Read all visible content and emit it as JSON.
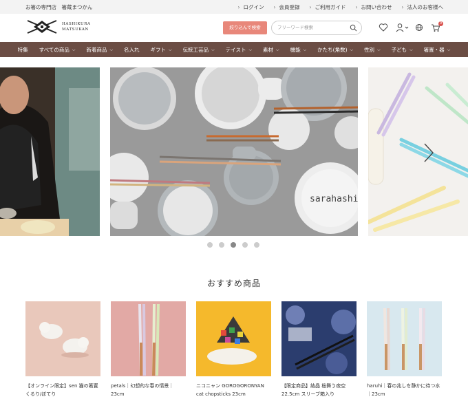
{
  "topbar": {
    "store_name": "お箸の専門店　箸蔵まつかん",
    "links": [
      "ログイン",
      "会員登録",
      "ご利用ガイド",
      "お問い合わせ",
      "法人のお客様へ"
    ]
  },
  "header": {
    "logo_line1": "HASHIKURA",
    "logo_line2": "MATSUKAN",
    "filter_button": "絞り込んで検索",
    "search_placeholder": "フリーワード検索",
    "cart_count": "0"
  },
  "nav": {
    "items": [
      "特集",
      "すべての商品",
      "新着商品",
      "名入れ",
      "ギフト",
      "伝統工芸品",
      "テイスト",
      "素材",
      "機能",
      "かたち(角数)",
      "性別",
      "子ども",
      "箸置・器"
    ]
  },
  "carousel": {
    "center_brand": "sarahashi",
    "dots_total": 5,
    "active_dot": 3
  },
  "recommend": {
    "title": "おすすめ商品",
    "products": [
      {
        "name": "【オンライン限定】sen 猫の箸置 くるり/ぼてり"
      },
      {
        "name": "petals｜幻想的な春の情景｜23cm"
      },
      {
        "name": "ニコニャン GOROGORONYAN cat chopsticks 23cm"
      },
      {
        "name": "【限定商品】結晶 桜舞う夜空 22.5cm スリーブ箱入り"
      },
      {
        "name": "haruhi｜春の兆しを静かに待つ水｜23cm"
      }
    ]
  },
  "colors": {
    "nav_bg": "#6b4d44",
    "filter_btn": "#e8877a",
    "badge": "#d9534f"
  }
}
